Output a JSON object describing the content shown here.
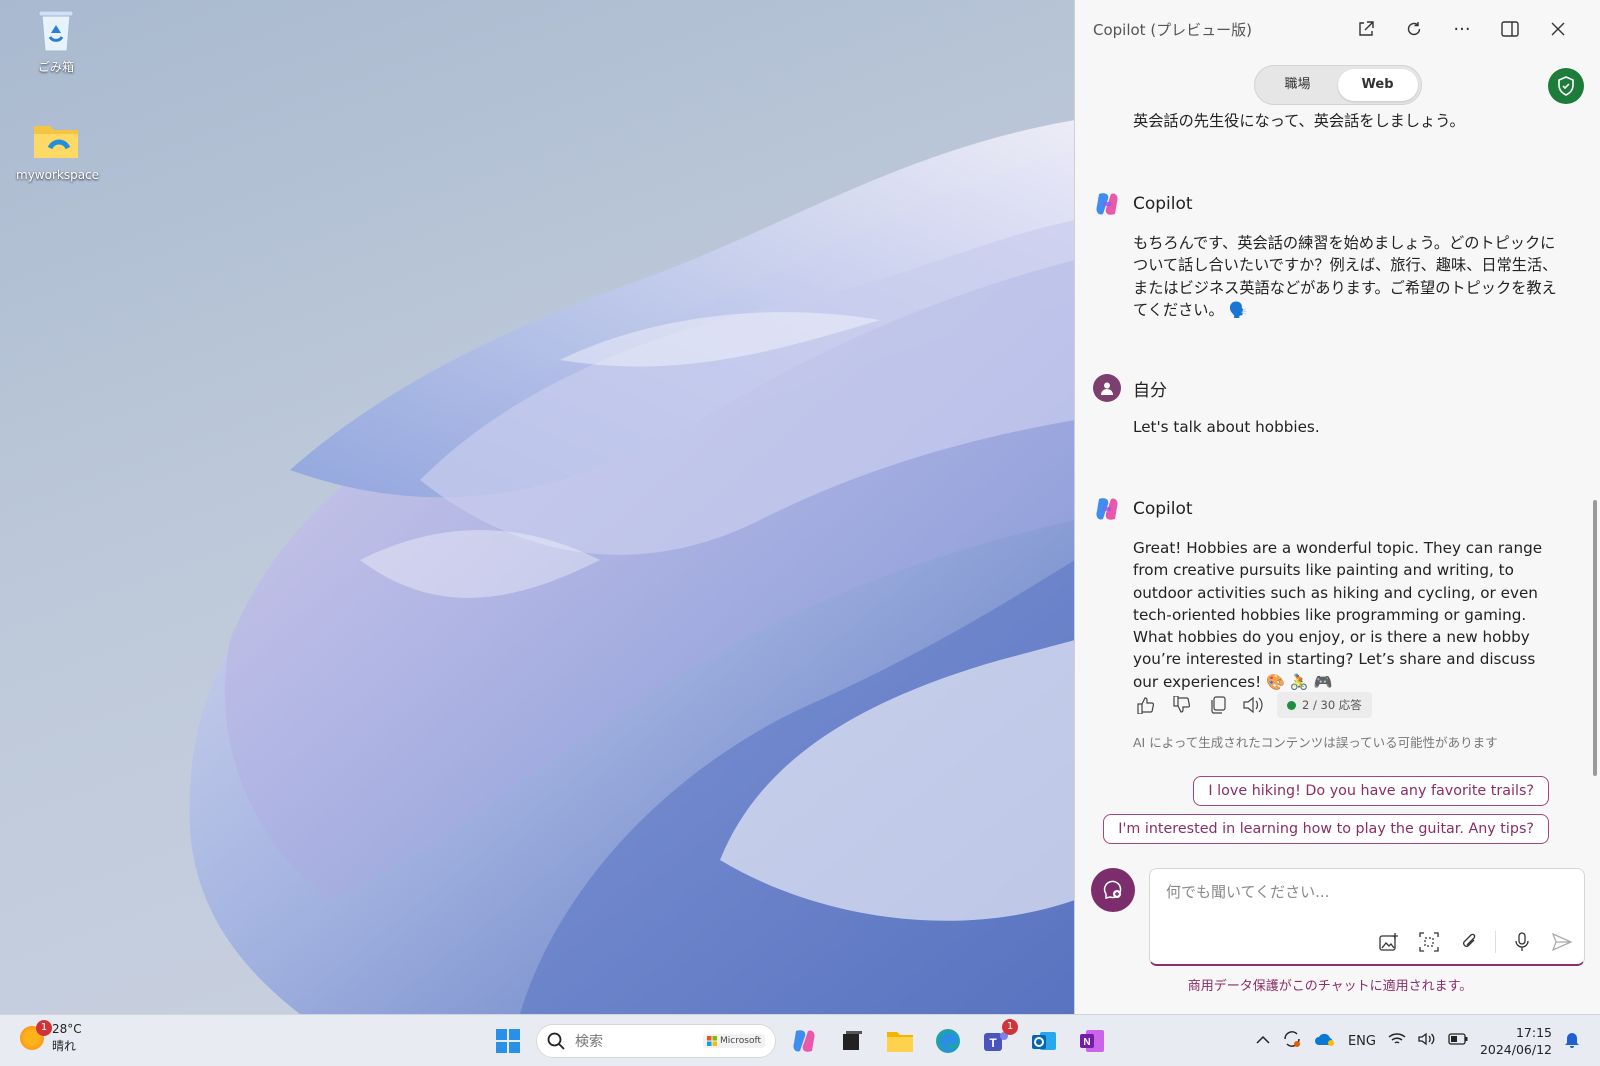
{
  "desktop": {
    "icons": [
      {
        "label": "ごみ箱",
        "icon": "recycle-bin-icon"
      },
      {
        "label": "myworkspace",
        "icon": "folder-icon"
      }
    ]
  },
  "panel": {
    "title": "Copilot (プレビュー版)",
    "tabs": [
      {
        "label": "職場",
        "active": false
      },
      {
        "label": "Web",
        "active": true
      }
    ],
    "messages": [
      {
        "text": "英会話の先生役になって、英会話をしましょう。"
      },
      {
        "author": "Copilot",
        "text": "もちろんです、英会話の練習を始めましょう。どのトピックについて話し合いたいですか？例えば、旅行、趣味、日常生活、またはビジネス英語などがあります。ご希望のトピックを教えてください。 🗣️"
      },
      {
        "author": "自分",
        "text": "Let's talk about hobbies."
      },
      {
        "author": "Copilot",
        "text": "Great! Hobbies are a wonderful topic. They can range from creative pursuits like painting and writing, to outdoor activities such as hiking and cycling, or even tech-oriented hobbies like programming or gaming. What hobbies do you enjoy, or is there a new hobby you’re interested in starting? Let’s share and discuss our experiences! 🎨 🚴 🎮"
      }
    ],
    "response_count": "2 / 30 応答",
    "disclaimer": "AI によって生成されたコンテンツは誤っている可能性があります",
    "suggestions": [
      "I love hiking! Do you have any favorite trails?",
      "I'm interested in learning how to play the guitar. Any tips?"
    ],
    "composer_placeholder": "何でも聞いてください...",
    "protection_notice": "商用データ保護がこのチャットに適用されます。"
  },
  "taskbar": {
    "weather_temp": "28°C",
    "weather_desc": "晴れ",
    "weather_badge": "1",
    "search_placeholder": "検索",
    "search_pill": "Microsoft",
    "teams_badge": "1",
    "lang": "ENG",
    "time": "17:15",
    "date": "2024/06/12"
  },
  "colors": {
    "accent": "#8b2d66",
    "shield": "#1e7c3a",
    "status_dot": "#1e8f3e"
  }
}
